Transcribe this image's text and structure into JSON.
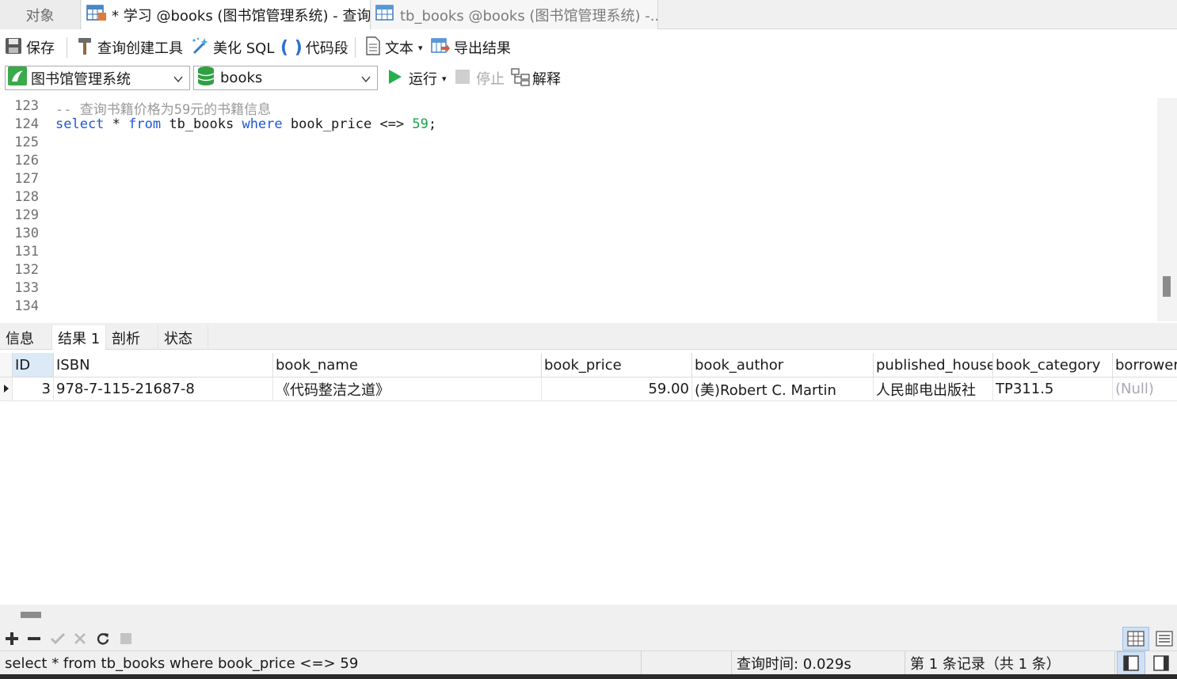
{
  "tabs": {
    "objects": "对象",
    "query_tab": "* 学习 @books (图书馆管理系统) - 查询",
    "table_tab": "tb_books @books (图书馆管理系统) -..."
  },
  "toolbar": {
    "save": "保存",
    "query_builder": "查询创建工具",
    "beautify_sql": "美化 SQL",
    "code_snippet": "代码段",
    "text": "文本",
    "export_result": "导出结果",
    "connection": "图书馆管理系统",
    "database": "books",
    "run": "运行",
    "stop": "停止",
    "explain": "解释"
  },
  "editor": {
    "lines": [
      {
        "no": "123",
        "kind": "comment",
        "text": "-- 查询书籍价格为59元的书籍信息"
      },
      {
        "no": "124",
        "kind": "sql"
      },
      {
        "no": "125"
      },
      {
        "no": "126"
      },
      {
        "no": "127"
      },
      {
        "no": "128"
      },
      {
        "no": "129"
      },
      {
        "no": "130"
      },
      {
        "no": "131"
      },
      {
        "no": "132"
      },
      {
        "no": "133"
      },
      {
        "no": "134"
      }
    ],
    "sql_tokens": {
      "select": "select",
      "star": " * ",
      "from": "from",
      "table": " tb_books ",
      "where": "where",
      "cond": " book_price <=> ",
      "value": "59",
      "end": ";"
    }
  },
  "result_tabs": [
    "信息",
    "结果 1",
    "剖析",
    "状态"
  ],
  "grid": {
    "columns": [
      "ID",
      "ISBN",
      "book_name",
      "book_price",
      "book_author",
      "published_house",
      "book_category",
      "borrower"
    ],
    "rows": [
      [
        "3",
        "978-7-115-21687-8",
        "《代码整洁之道》",
        "59.00",
        "(美)Robert C. Martin",
        "人民邮电出版社",
        "TP311.5",
        "(Null)"
      ]
    ]
  },
  "status": {
    "sql": "select * from tb_books where book_price <=> 59",
    "query_time": "查询时间: 0.029s",
    "record": "第 1 条记录（共 1 条）"
  },
  "colors": {
    "keyword": "#1f57d6",
    "number": "#16a34a",
    "comment": "#9a9a9a",
    "run_green": "#22b14c"
  }
}
